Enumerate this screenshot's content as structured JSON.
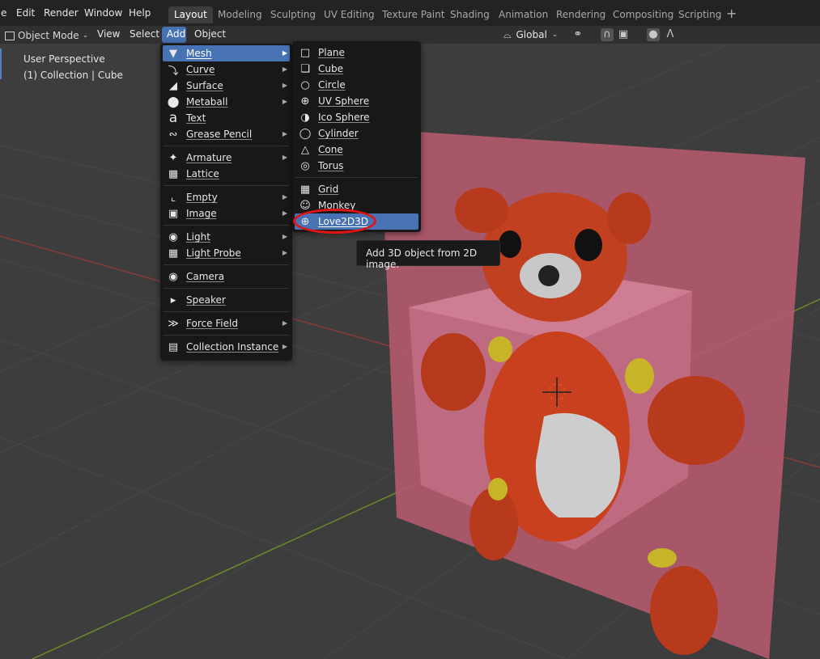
{
  "topbar": {
    "menus": [
      "e",
      "Edit",
      "Render",
      "Window",
      "Help"
    ],
    "workspaces": [
      "Layout",
      "Modeling",
      "Sculpting",
      "UV Editing",
      "Texture Paint",
      "Shading",
      "Animation",
      "Rendering",
      "Compositing",
      "Scripting"
    ],
    "active_workspace": "Layout",
    "add_workspace_icon": "plus-icon"
  },
  "header": {
    "mode": "Object Mode",
    "view": "View",
    "select": "Select",
    "add": "Add",
    "object": "Object",
    "orientation": "Global",
    "icons": [
      "transform-orientation-icon",
      "pivot-icon",
      "snap-icon",
      "snap-target-icon",
      "proportional-edit-icon",
      "falloff-icon"
    ]
  },
  "viewport": {
    "perspective_label": "User Perspective",
    "collection_label": "(1) Collection | Cube"
  },
  "add_menu": {
    "items": [
      {
        "label": "Mesh",
        "icon": "mesh-icon",
        "submenu": true,
        "highlighted": true
      },
      {
        "label": "Curve",
        "icon": "curve-icon",
        "submenu": true
      },
      {
        "label": "Surface",
        "icon": "surface-icon",
        "submenu": true
      },
      {
        "label": "Metaball",
        "icon": "metaball-icon",
        "submenu": true
      },
      {
        "label": "Text",
        "icon": "text-icon",
        "submenu": false
      },
      {
        "label": "Grease Pencil",
        "icon": "grease-pencil-icon",
        "submenu": true
      },
      {
        "label": "Armature",
        "icon": "armature-icon",
        "submenu": true
      },
      {
        "label": "Lattice",
        "icon": "lattice-icon",
        "submenu": false
      },
      {
        "label": "Empty",
        "icon": "empty-icon",
        "submenu": true
      },
      {
        "label": "Image",
        "icon": "image-icon",
        "submenu": true
      },
      {
        "label": "Light",
        "icon": "light-icon",
        "submenu": true
      },
      {
        "label": "Light Probe",
        "icon": "light-probe-icon",
        "submenu": true
      },
      {
        "label": "Camera",
        "icon": "camera-icon",
        "submenu": false
      },
      {
        "label": "Speaker",
        "icon": "speaker-icon",
        "submenu": false
      },
      {
        "label": "Force Field",
        "icon": "force-field-icon",
        "submenu": true
      },
      {
        "label": "Collection Instance",
        "icon": "collection-instance-icon",
        "submenu": true
      }
    ]
  },
  "mesh_submenu": {
    "items": [
      {
        "label": "Plane",
        "icon": "plane-icon"
      },
      {
        "label": "Cube",
        "icon": "cube-icon"
      },
      {
        "label": "Circle",
        "icon": "circle-icon"
      },
      {
        "label": "UV Sphere",
        "icon": "uv-sphere-icon"
      },
      {
        "label": "Ico Sphere",
        "icon": "ico-sphere-icon"
      },
      {
        "label": "Cylinder",
        "icon": "cylinder-icon"
      },
      {
        "label": "Cone",
        "icon": "cone-icon"
      },
      {
        "label": "Torus",
        "icon": "torus-icon"
      },
      {
        "label": "Grid",
        "icon": "grid-icon"
      },
      {
        "label": "Monkey",
        "icon": "monkey-icon"
      },
      {
        "label": "Love2D3D",
        "icon": "love2d3d-icon",
        "highlighted": true
      }
    ]
  },
  "tooltip": {
    "text": "Add 3D object from 2D image."
  },
  "colors": {
    "accent": "#4772b3",
    "annotation_ring": "#e01414",
    "viewport_bg": "#3d3d3d",
    "menu_bg": "#181818"
  }
}
